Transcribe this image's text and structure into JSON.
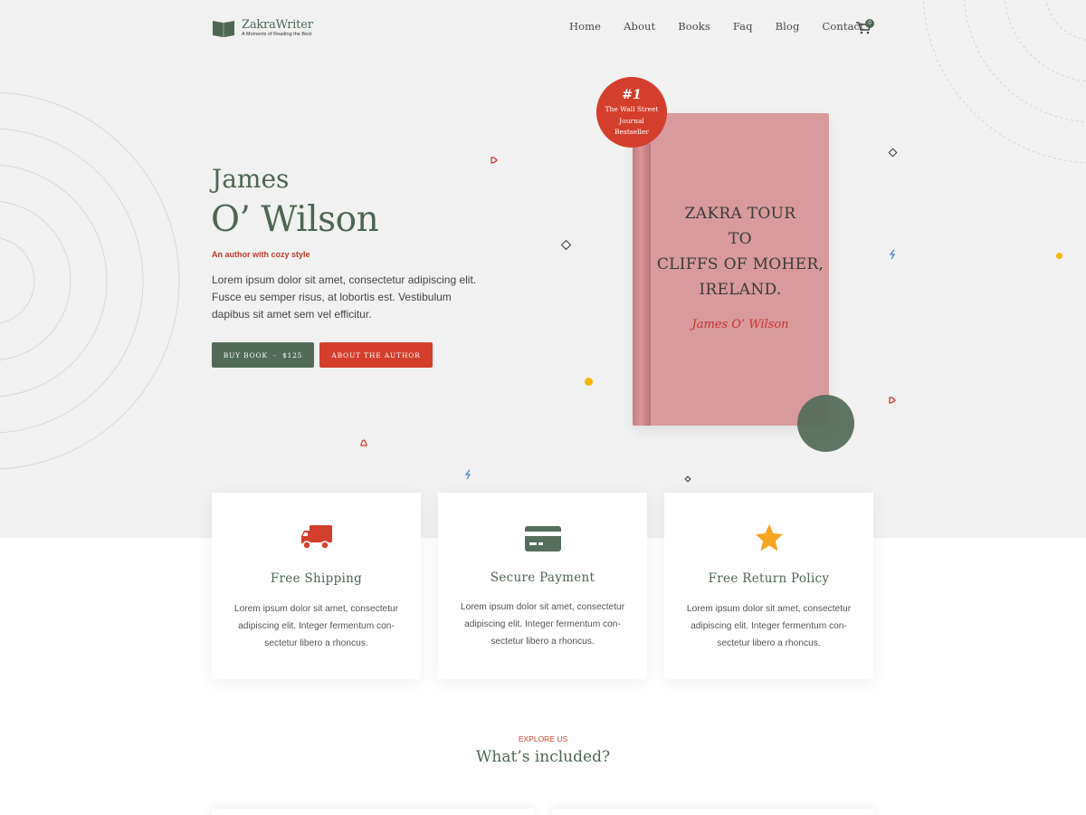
{
  "brand": {
    "name": "ZakraWriter",
    "tagline": "A Moments of Reading the Best",
    "icon": "open-book-icon"
  },
  "nav": {
    "items": [
      {
        "label": "Home"
      },
      {
        "label": "About"
      },
      {
        "label": "Books"
      },
      {
        "label": "Faq"
      },
      {
        "label": "Blog"
      },
      {
        "label": "Contact"
      }
    ],
    "cart_icon": "cart-icon",
    "cart_count": "0"
  },
  "hero": {
    "first_name": "James",
    "last_name": "O’ Wilson",
    "tagline": "An author with cozy style",
    "description": "Lorem ipsum dolor sit amet, consectetur adipiscing elit. Fusce eu semper risus, at lobortis est. Vestibulum dapibus sit amet sem vel efficitur.",
    "buy_button": "BUY BOOK  -  $125",
    "author_button": "ABOUT THE AUTHOR"
  },
  "book": {
    "title_lines": [
      "ZAKRA TOUR",
      "TO",
      "CLIFFS OF MOHER,",
      "IRELAND."
    ],
    "author": "James O’ Wilson",
    "cover_color": "#d89a9d",
    "badge": {
      "number": "#1",
      "lines": [
        "The Wall Street",
        "Journal",
        "Bestseller"
      ]
    }
  },
  "features": [
    {
      "icon": "truck-icon",
      "title": "Free Shipping",
      "text": "Lorem ipsum dolor sit amet, consectetur adipiscing elit. Integer fermentum con-sectetur libero a rhoncus."
    },
    {
      "icon": "credit-card-icon",
      "title": "Secure Payment",
      "text": "Lorem ipsum dolor sit amet, consectetur adipiscing elit. Integer fermentum con-sectetur libero a rhoncus."
    },
    {
      "icon": "star-icon",
      "title": "Free Return Policy",
      "text": "Lorem ipsum dolor sit amet, consectetur adipiscing elit. Integer fermentum con-sectetur libero a rhoncus."
    }
  ],
  "explore": {
    "label": "EXPLORE US",
    "title": "What’s included?"
  },
  "colors": {
    "primary_green": "#4e6654",
    "accent_red": "#d43e2c",
    "hero_background": "#f0f1f0",
    "star_yellow": "#f5a623"
  }
}
